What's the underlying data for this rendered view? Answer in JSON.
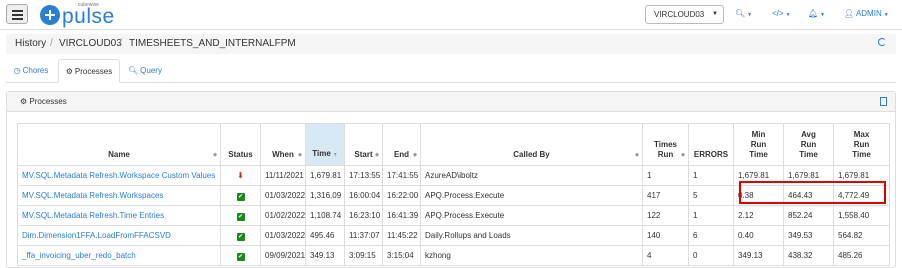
{
  "navbar": {
    "logo_small": "cubewise",
    "logo_text": "pulse",
    "server": "VIRCLOUD03",
    "user": "ADMIN"
  },
  "breadcrumb": [
    "History",
    "VIRCLOUD03",
    "TIMESHEETS_AND_INTERNALFPM"
  ],
  "tabs": [
    {
      "label": "Chores",
      "icon": "clock-icon"
    },
    {
      "label": "Processes",
      "icon": "gears-icon"
    },
    {
      "label": "Query",
      "icon": "search-icon"
    }
  ],
  "panel": {
    "title": "Processes"
  },
  "table": {
    "headers": [
      [
        "Name"
      ],
      [
        "Status"
      ],
      [
        "When"
      ],
      [
        "Time"
      ],
      [
        "Start"
      ],
      [
        "End"
      ],
      [
        "Called By"
      ],
      [
        "Times",
        "Run"
      ],
      [
        "ERRORS"
      ],
      [
        "Min",
        "Run",
        "Time"
      ],
      [
        "Avg",
        "Run",
        "Time"
      ],
      [
        "Max",
        "Run",
        "Time"
      ]
    ],
    "rows": [
      {
        "name": "MV.SQL.Metadata Refresh.Workspace Custom Values",
        "status": "error",
        "when": "11/11/2021",
        "time": "1,679.81",
        "start": "17:13:55",
        "end": "17:41:55",
        "called_by": "AzureAD\\iboltz",
        "times_run": "1",
        "errors": "1",
        "min": "1,679.81",
        "avg": "1,679.81",
        "max": "1,679.81"
      },
      {
        "name": "MV.SQL.Metadata Refresh.Workspaces",
        "status": "ok",
        "when": "01/03/2022",
        "time": "1,316.09",
        "start": "16:00:04",
        "end": "16:22:00",
        "called_by": "APQ.Process.Execute",
        "times_run": "417",
        "errors": "5",
        "min": "0.38",
        "avg": "464.43",
        "max": "4,772.49"
      },
      {
        "name": "MV.SQL.Metadata Refresh.Time Entries",
        "status": "ok",
        "when": "01/02/2022",
        "time": "1,108.74",
        "start": "16:23:10",
        "end": "16:41:39",
        "called_by": "APQ.Process.Execute",
        "times_run": "122",
        "errors": "1",
        "min": "2.12",
        "avg": "852.24",
        "max": "1,558.40"
      },
      {
        "name": "Dim.Dimension1FFA.LoadFromFFACSVD",
        "status": "ok",
        "when": "01/03/2022",
        "time": "495.46",
        "start": "11:37:07",
        "end": "11:45:22",
        "called_by": "Daily.Rollups and Loads",
        "times_run": "140",
        "errors": "6",
        "min": "0.40",
        "avg": "349.53",
        "max": "564.82"
      },
      {
        "name": "_ffa_invoicing_uber_redo_batch",
        "status": "ok",
        "when": "09/09/2021",
        "time": "349.13",
        "start": "3:09:15",
        "end": "3:15:04",
        "called_by": "kzhong",
        "times_run": "4",
        "errors": "0",
        "min": "349.13",
        "avg": "438.32",
        "max": "485.26"
      }
    ]
  }
}
